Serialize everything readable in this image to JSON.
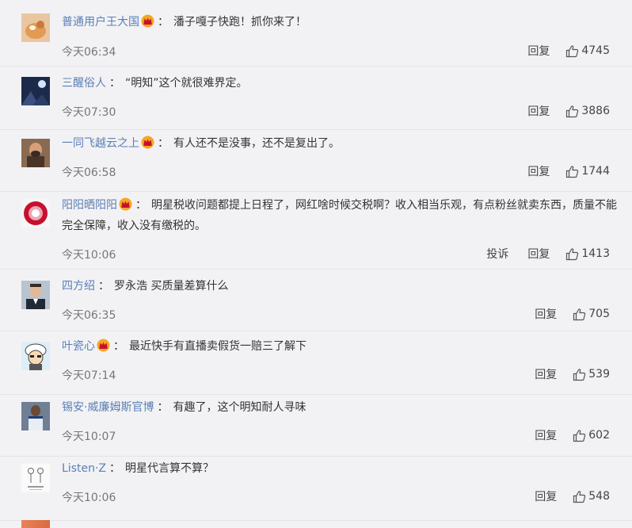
{
  "comments": [
    {
      "user": "普通用户王大国",
      "badge": true,
      "text": "潘子嘎子快跑！抓你来了！",
      "time": "今天06:34",
      "reply": "回复",
      "report": "",
      "likes": "4745"
    },
    {
      "user": "三醒俗人",
      "badge": false,
      "text": "“明知”这个就很难界定。",
      "time": "今天07:30",
      "reply": "回复",
      "report": "",
      "likes": "3886"
    },
    {
      "user": "一同飞越云之上",
      "badge": true,
      "text": "有人还不是没事，还不是复出了。",
      "time": "今天06:58",
      "reply": "回复",
      "report": "",
      "likes": "1744"
    },
    {
      "user": "阳阳晒阳阳",
      "badge": true,
      "text": "明星税收问题都提上日程了，网红啥时候交税啊？收入相当乐观，有点粉丝就卖东西，质量不能完全保障，收入没有缴税的。",
      "time": "今天10:06",
      "reply": "回复",
      "report": "投诉",
      "likes": "1413"
    },
    {
      "user": "四方绍",
      "badge": false,
      "text": "罗永浩 买质量差算什么",
      "time": "今天06:35",
      "reply": "回复",
      "report": "",
      "likes": "705"
    },
    {
      "user": "叶瓷心",
      "badge": true,
      "text": "最近快手有直播卖假货一赔三了解下",
      "time": "今天07:14",
      "reply": "回复",
      "report": "",
      "likes": "539"
    },
    {
      "user": "锡安·威廉姆斯官博",
      "badge": false,
      "text": "有趣了，这个明知耐人寻味",
      "time": "今天10:07",
      "reply": "回复",
      "report": "",
      "likes": "602"
    },
    {
      "user": "Listen·Z",
      "badge": false,
      "text": "明星代言算不算？",
      "time": "今天10:06",
      "reply": "回复",
      "report": "",
      "likes": "548"
    }
  ],
  "icons": {
    "badge": "crown-badge-icon",
    "like": "thumbs-up-icon"
  },
  "colors": {
    "username": "#5b7fb5",
    "background": "#f2f2f5",
    "badge": "#f5a623"
  }
}
